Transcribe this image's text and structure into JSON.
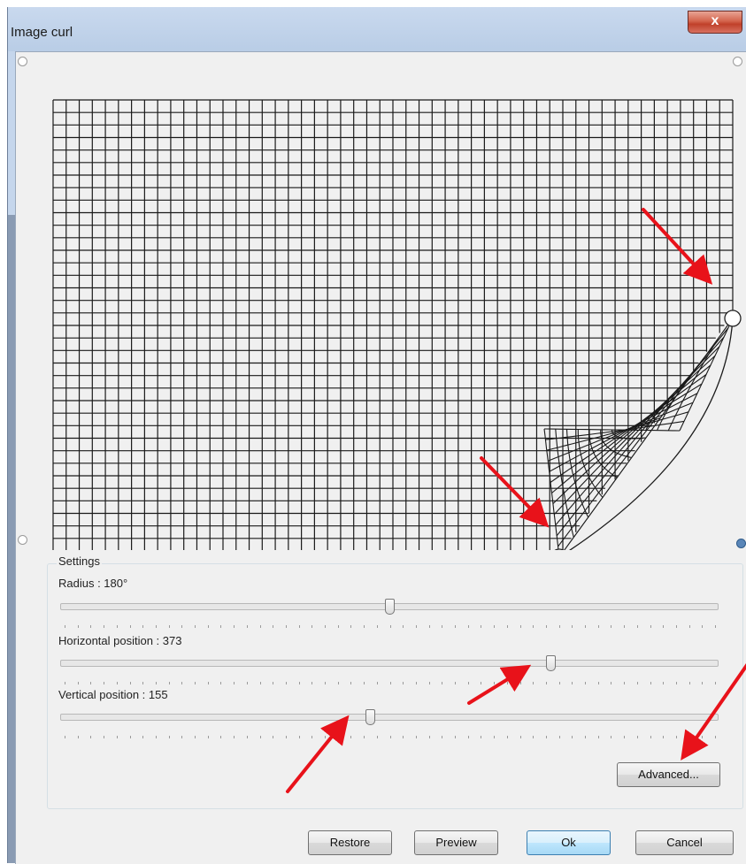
{
  "window": {
    "title": "Image curl",
    "close_label": "x"
  },
  "settings": {
    "group_label": "Settings",
    "sliders": [
      {
        "id": "radius",
        "label": "Radius : 180°",
        "value": 180,
        "fraction": 0.5
      },
      {
        "id": "horizontal",
        "label": "Horizontal position : 373",
        "value": 373,
        "fraction": 0.745
      },
      {
        "id": "vertical",
        "label": "Vertical position : 155",
        "value": 155,
        "fraction": 0.47
      }
    ],
    "advanced_label": "Advanced..."
  },
  "buttons": {
    "restore": "Restore",
    "preview": "Preview",
    "ok": "Ok",
    "cancel": "Cancel"
  },
  "icons": {
    "curl_handle": "curl-handle-icon",
    "corner_handle": "corner-handle-icon",
    "annotation": "red-arrow-icon"
  },
  "colors": {
    "annotation_arrow": "#e8121a",
    "window_frame": "#c5d6ec",
    "close_button": "#c9432d",
    "default_button_border": "#3c7fb1"
  }
}
